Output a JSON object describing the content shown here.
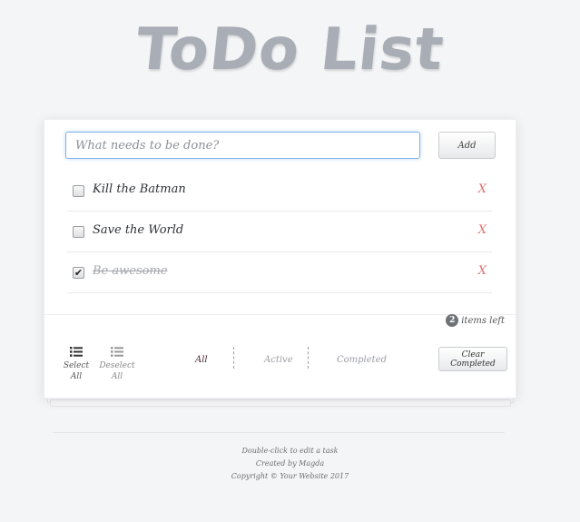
{
  "app": {
    "title": "ToDo List"
  },
  "new_todo": {
    "placeholder": "What needs to be done?",
    "value": ""
  },
  "add_button": {
    "label": "Add"
  },
  "todos": [
    {
      "label": "Kill the Batman",
      "completed": false,
      "delete_label": "X"
    },
    {
      "label": "Save the World",
      "completed": false,
      "delete_label": "X"
    },
    {
      "label": "Be awesome",
      "completed": true,
      "delete_label": "X"
    }
  ],
  "counter": {
    "count": "2",
    "suffix": "items left"
  },
  "bulk": {
    "select_all": [
      "Select",
      "All"
    ],
    "deselect_all": [
      "Deselect",
      "All"
    ]
  },
  "filters": {
    "all": "All",
    "active": "Active",
    "completed": "Completed",
    "selected": "All"
  },
  "clear_button": {
    "label": "Clear Completed"
  },
  "footer": {
    "hint": "Double-click to edit a task",
    "credit": "Created by Magda",
    "copyright": "Copyright © Your Website 2017"
  },
  "colors": {
    "title": "#a9adb5",
    "focus_border": "#7fb3e6",
    "delete": "#d9736f",
    "selected_filter": "#4a2b34",
    "background": "#f4f5f7"
  },
  "icons": {
    "select_all": "list-icon",
    "deselect_all": "list-icon",
    "checkmark": "checkmark-icon"
  }
}
